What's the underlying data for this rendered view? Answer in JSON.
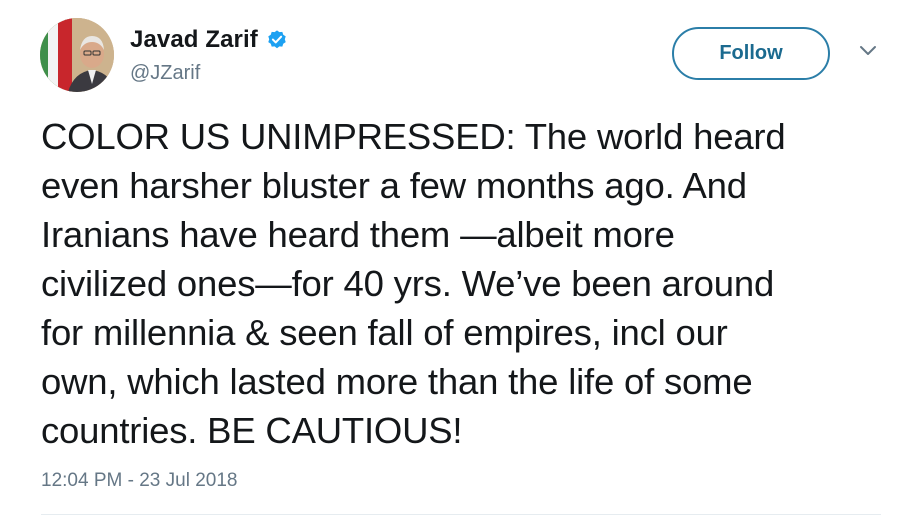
{
  "author": {
    "display_name": "Javad Zarif",
    "screen_name": "@JZarif",
    "verified_icon": "verified-badge-icon",
    "avatar_icon": "profile-photo"
  },
  "actions": {
    "follow_label": "Follow",
    "menu_icon": "chevron-down-icon"
  },
  "tweet": {
    "text": "COLOR US UNIMPRESSED: The world heard\neven harsher bluster a few months ago. And\nIranians have heard them —albeit more\ncivilized ones—for 40 yrs. We’ve been around\nfor millennia & seen fall of empires, incl our\nown, which lasted more than the life of some\ncountries. BE CAUTIOUS!",
    "timestamp": "12:04 PM - 23 Jul 2018"
  },
  "colors": {
    "accent": "#1da1f2",
    "follow_text": "#1b6a8f",
    "secondary_text": "#657786",
    "primary_text": "#14171a"
  }
}
